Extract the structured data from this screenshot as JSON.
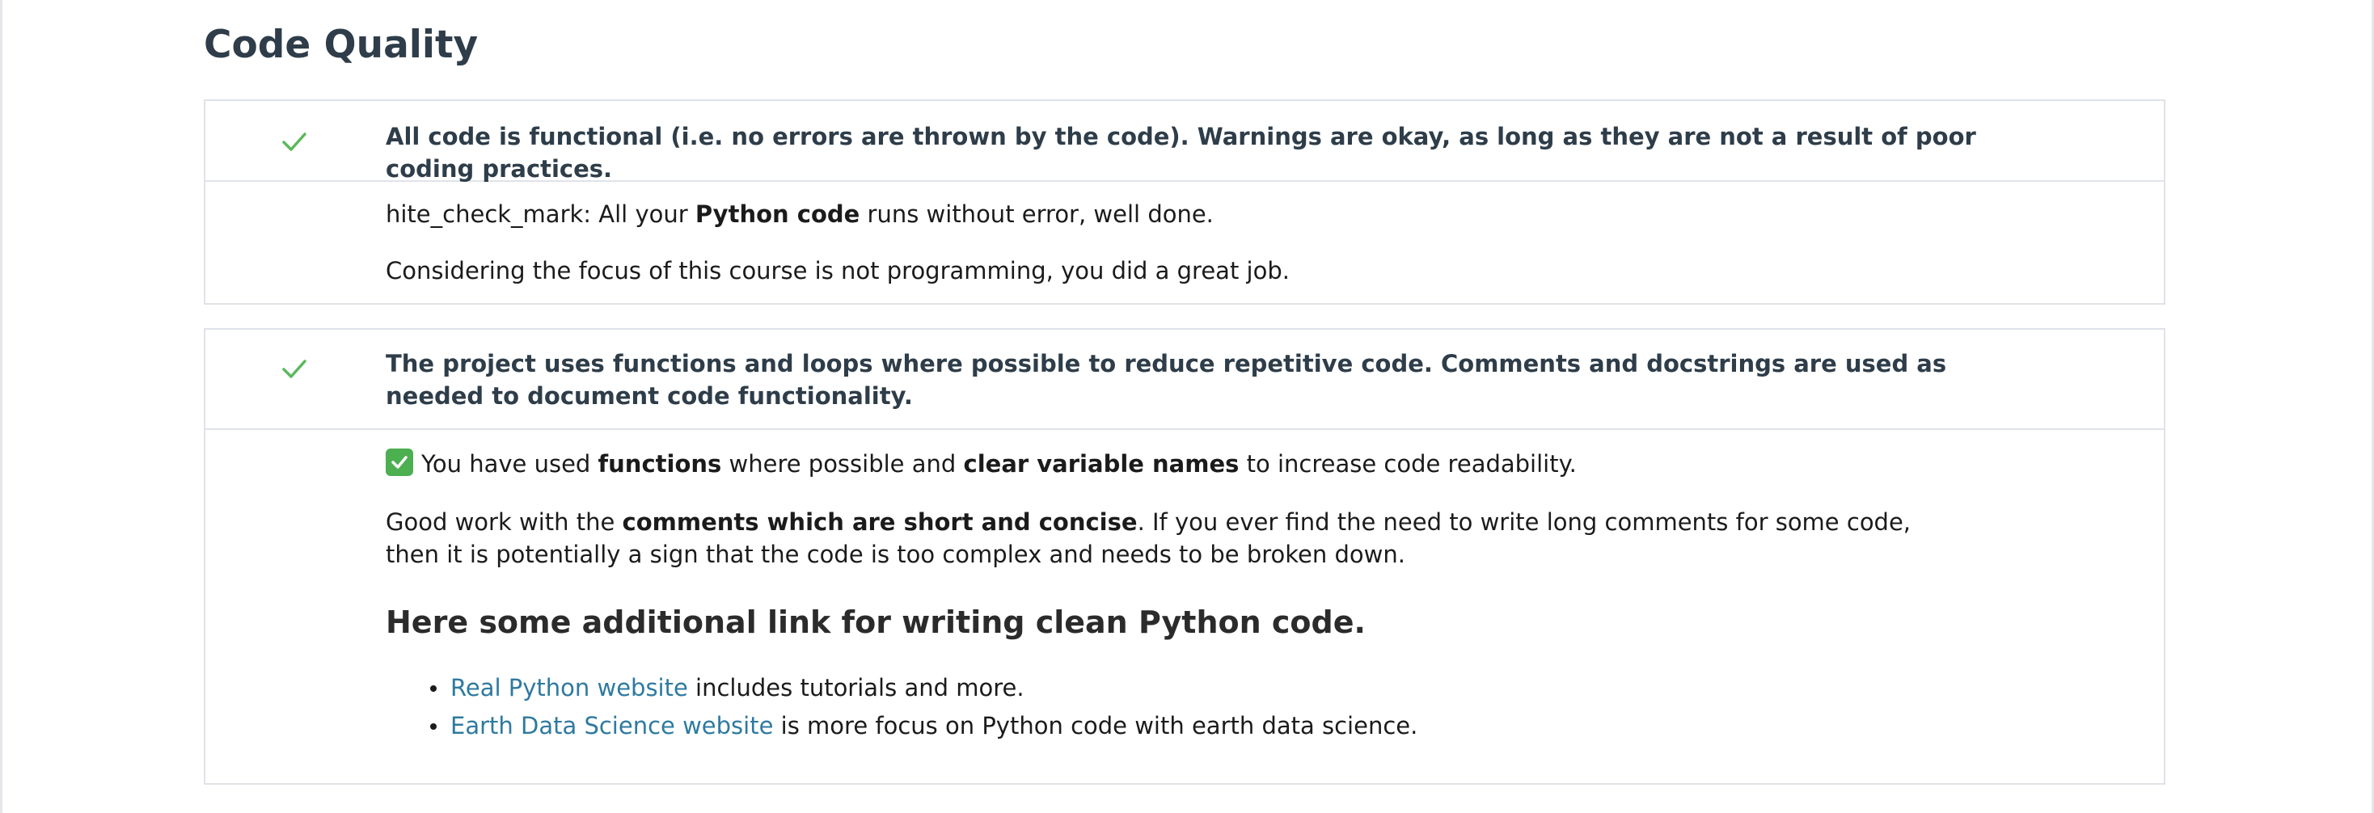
{
  "section": {
    "title": "Code Quality"
  },
  "criteria": [
    {
      "criterion": "All code is functional (i.e. no errors are thrown by the code). Warnings are okay, as long as they are not a result of poor coding practices.",
      "status_icon": "check-icon",
      "review": {
        "p1_prefix": "hite_check_mark: All your ",
        "p1_bold": "Python code",
        "p1_suffix": " runs without error, well done.",
        "p2": "Considering the focus of this course is not programming, you did a great job."
      }
    },
    {
      "criterion": "The project uses functions and loops where possible to reduce repetitive code. Comments and docstrings are used as needed to document code functionality.",
      "status_icon": "check-icon",
      "review": {
        "p1_emoji": "white-check-mark-emoji",
        "p1_a": "You have used ",
        "p1_b1": "functions",
        "p1_c": " where possible and ",
        "p1_b2": "clear variable names",
        "p1_d": " to increase code readability.",
        "p2_a": "Good work with the ",
        "p2_b": "comments which are short and concise",
        "p2_c": ". If you ever find the need to write long comments for some code, then it is potentially a sign that the code is too complex and needs to be broken down.",
        "subheading": "Here some additional link for writing clean Python code.",
        "links": [
          {
            "link_text": "Real Python website",
            "rest": " includes tutorials and more."
          },
          {
            "link_text": "Earth Data Science website",
            "rest": " is more focus on Python code with earth data science."
          }
        ]
      }
    }
  ],
  "colors": {
    "accent_check": "#5cb85c",
    "link": "#2e7aa0",
    "heading": "#2e3d49"
  }
}
